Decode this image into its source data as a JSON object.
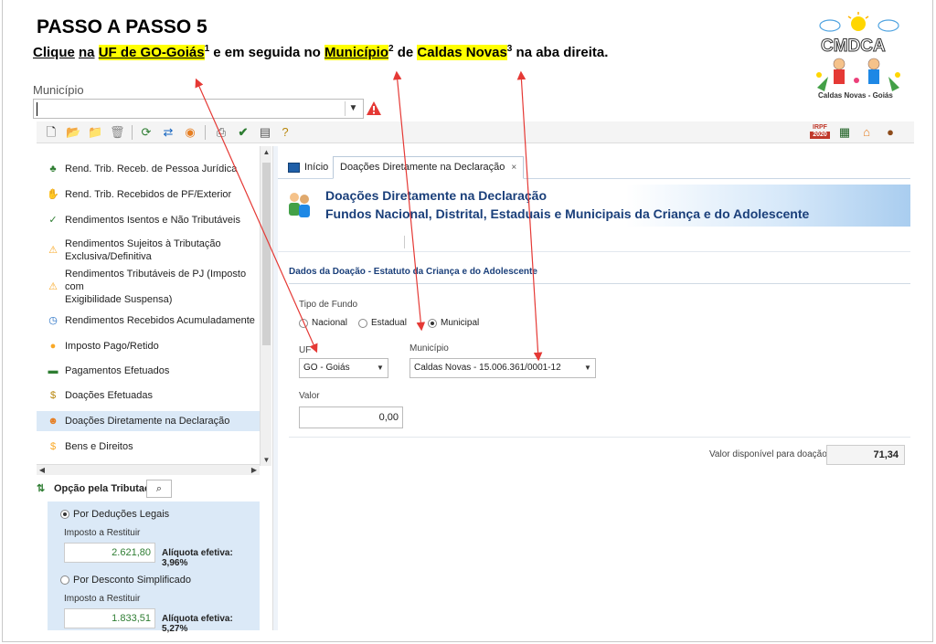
{
  "slide": {
    "heading": "PASSO A PASSO 5",
    "instruction": {
      "w1": "Clique",
      "w2": "na",
      "uf": "UF de GO-Goiás",
      "sup1": "1",
      "mid": " e em seguida no ",
      "municipio": "Município",
      "sup2": "2",
      "de": " de ",
      "city": "Caldas Novas",
      "sup3": "3",
      "end": " na aba direita."
    },
    "logo_text": "CMDCA",
    "logo_caption": "Caldas Novas - Goiás"
  },
  "municipio_field": {
    "label": "Município",
    "value": ""
  },
  "toolbar": {
    "irpf_top": "IRPF",
    "irpf_bottom": "2020"
  },
  "sidebar": {
    "items": [
      {
        "label": "Rend. Trib. Receb. de Pessoa Jurídica",
        "icon": "person-money-icon"
      },
      {
        "label": "Rend. Trib. Recebidos de PF/Exterior",
        "icon": "hand-money-icon"
      },
      {
        "label": "Rendimentos Isentos e Não Tributáveis",
        "icon": "doc-check-icon"
      },
      {
        "label": "Rendimentos Sujeitos à Tributação",
        "label2": "Exclusiva/Definitiva",
        "icon": "doc-warning-icon"
      },
      {
        "label": "Rendimentos Tributáveis de PJ (Imposto com",
        "label2": "Exigibilidade Suspensa)",
        "icon": "person-warning-icon"
      },
      {
        "label": "Rendimentos Recebidos Acumuladamente",
        "icon": "doc-clock-icon"
      },
      {
        "label": "Imposto Pago/Retido",
        "icon": "coin-person-icon"
      },
      {
        "label": "Pagamentos Efetuados",
        "icon": "card-icon"
      },
      {
        "label": "Doações Efetuadas",
        "icon": "donation-doc-icon"
      },
      {
        "label": "Doações Diretamente na Declaração",
        "icon": "people-icon"
      },
      {
        "label": "Bens e Direitos",
        "icon": "coin-icon"
      }
    ]
  },
  "tax_option": {
    "header": "Opção pela Tributação:",
    "opt1": "Por Deduções Legais",
    "opt1_selected": true,
    "restituir_label1": "Imposto a Restituir",
    "restituir_value1": "2.621,80",
    "aliquota1": "Alíquota efetiva: 3,96%",
    "opt2": "Por Desconto Simplificado",
    "restituir_label2": "Imposto a Restituir",
    "restituir_value2": "1.833,51",
    "aliquota2": "Alíquota efetiva: 5,27%"
  },
  "tabs": {
    "home": "Início",
    "active": "Doações Diretamente na Declaração",
    "close": "×"
  },
  "banner": {
    "title": "Doações Diretamente na Declaração",
    "subtitle": "Fundos Nacional, Distrital, Estaduais e Municipais da Criança e do Adolescente"
  },
  "form": {
    "section_title": "Dados da Doação - Estatuto da Criança e do Adolescente",
    "tipo_fundo_label": "Tipo de Fundo",
    "fund_options": [
      "Nacional",
      "Estadual",
      "Municipal"
    ],
    "fund_selected": "Municipal",
    "uf_label": "UF",
    "uf_value": "GO - Goiás",
    "municipio_label": "Município",
    "municipio_value": "Caldas Novas - 15.006.361/0001-12",
    "valor_label": "Valor",
    "valor_value": "0,00",
    "avail_label": "Valor disponível para doação:",
    "avail_value": "71,34"
  },
  "colors": {
    "highlight": "#ffff00",
    "arrow": "#e53935",
    "title_blue": "#1a3f7a",
    "panel_blue": "#dbe9f7"
  }
}
